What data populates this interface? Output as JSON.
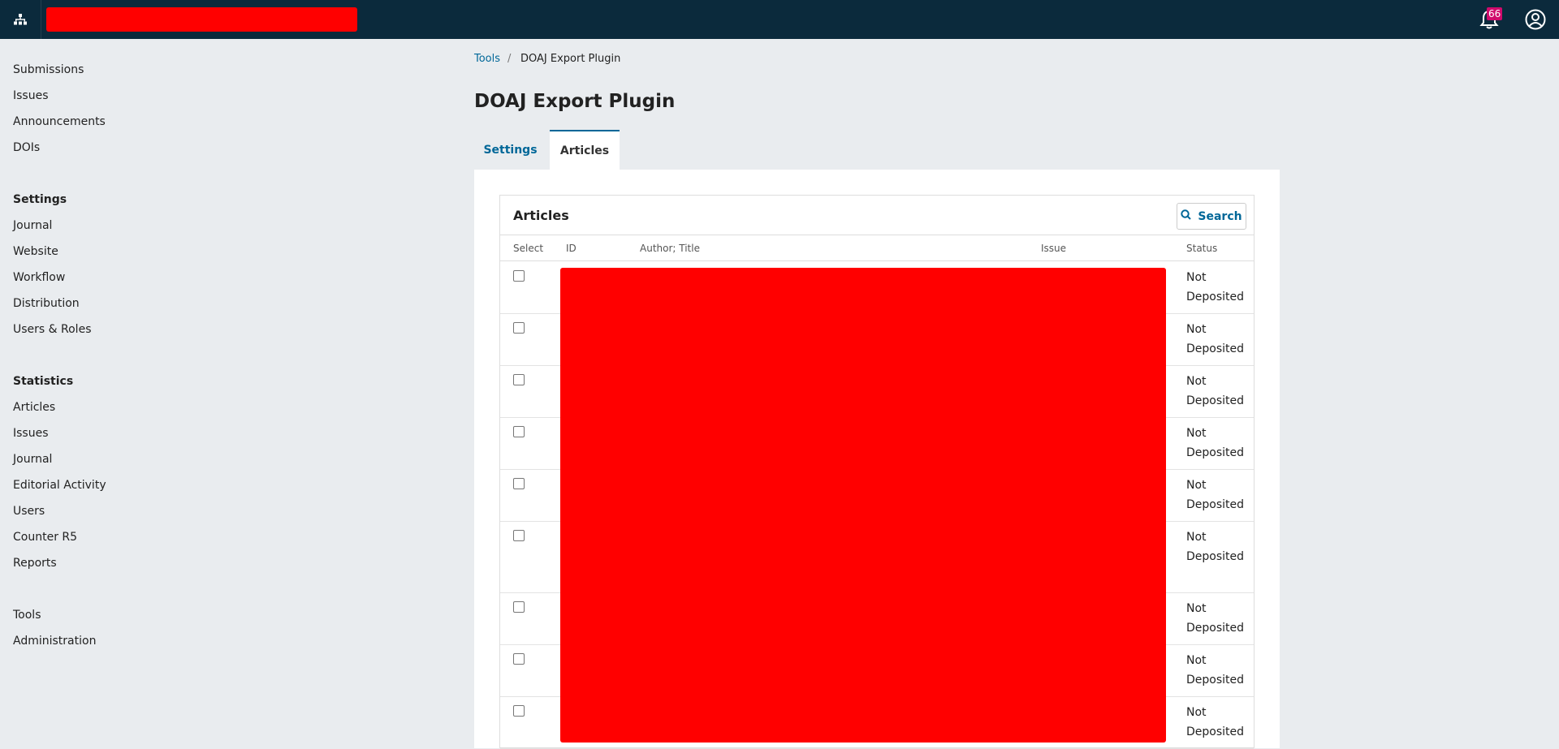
{
  "header": {
    "nav_icon": "sitemap-icon",
    "notifications_count": "66",
    "bell_icon": "bell-icon",
    "user_icon": "user-circle-icon"
  },
  "sidebar": {
    "items_main": [
      "Submissions",
      "Issues",
      "Announcements",
      "DOIs"
    ],
    "settings_heading": "Settings",
    "items_settings": [
      "Journal",
      "Website",
      "Workflow",
      "Distribution",
      "Users & Roles"
    ],
    "statistics_heading": "Statistics",
    "items_statistics": [
      "Articles",
      "Issues",
      "Journal",
      "Editorial Activity",
      "Users",
      "Counter R5",
      "Reports"
    ],
    "items_bottom": [
      "Tools",
      "Administration"
    ]
  },
  "breadcrumb": {
    "parent": "Tools",
    "separator": "/",
    "current": "DOAJ Export Plugin"
  },
  "page": {
    "title": "DOAJ Export Plugin",
    "tabs": [
      "Settings",
      "Articles"
    ],
    "active_tab": "Articles"
  },
  "grid": {
    "title": "Articles",
    "search_label": "Search",
    "search_icon": "search-icon",
    "columns": [
      "Select",
      "ID",
      "Author; Title",
      "Issue",
      "Status"
    ],
    "rows": [
      {
        "status_1": "Not",
        "status_2": "Deposited"
      },
      {
        "status_1": "Not",
        "status_2": "Deposited"
      },
      {
        "status_1": "Not",
        "status_2": "Deposited"
      },
      {
        "status_1": "Not",
        "status_2": "Deposited"
      },
      {
        "status_1": "Not",
        "status_2": "Deposited"
      },
      {
        "status_1": "Not",
        "status_2": "Deposited"
      },
      {
        "status_1": "Not",
        "status_2": "Deposited"
      },
      {
        "status_1": "Not",
        "status_2": "Deposited"
      },
      {
        "status_1": "Not",
        "status_2": "Deposited"
      }
    ]
  },
  "colors": {
    "topbar": "#0b2a3c",
    "link": "#006798",
    "badge": "#d00a6c",
    "redaction": "#ff0000"
  }
}
